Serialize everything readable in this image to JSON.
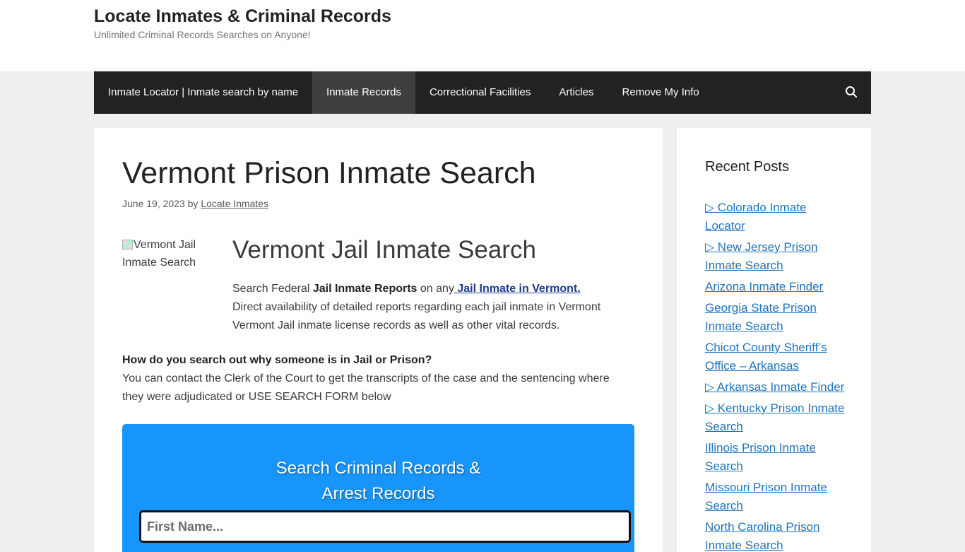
{
  "header": {
    "title": "Locate Inmates & Criminal Records",
    "tagline": "Unlimited Criminal Records Searches on Anyone!"
  },
  "nav": {
    "items": [
      {
        "label": "Inmate Locator | Inmate search by name",
        "active": false
      },
      {
        "label": "Inmate Records",
        "active": true
      },
      {
        "label": "Correctional Facilities",
        "active": false
      },
      {
        "label": "Articles",
        "active": false
      },
      {
        "label": "Remove My Info",
        "active": false
      }
    ],
    "search_icon": "search-icon"
  },
  "article": {
    "title": "Vermont Prison Inmate Search",
    "date": "June 19, 2023",
    "by": "by",
    "author": "Locate Inmates",
    "image_alt": "Vermont Jail Inmate Search",
    "subtitle": "Vermont Jail Inmate Search",
    "intro": {
      "p1": "Search Federal ",
      "bold": "Jail Inmate Reports",
      "p2": " on any",
      "link": " Jail Inmate in Vermont.",
      "p3": "Direct availability of detailed reports regarding each jail inmate in Vermont Vermont Jail inmate license records as well as other vital records."
    },
    "faq_question": "How do you search out why someone is in Jail or Prison?",
    "faq_answer": "You can contact the Clerk of the Court to get the transcripts of the case and the sentencing where they were adjudicated or USE SEARCH FORM below"
  },
  "search_form": {
    "title_line1": "Search Criminal Records &",
    "title_line2": "Arrest Records",
    "first_name_placeholder": "First Name..."
  },
  "sidebar": {
    "title": "Recent Posts",
    "posts": [
      "▷ Colorado Inmate Locator",
      "▷ New Jersey Prison Inmate Search",
      "Arizona Inmate Finder",
      "Georgia State Prison Inmate Search",
      "Chicot County Sheriff’s Office – Arkansas",
      "▷ Arkansas Inmate Finder",
      "▷ Kentucky Prison Inmate Search",
      "Illinois Prison Inmate Search",
      "Missouri Prison Inmate Search",
      "North Carolina Prison Inmate Search"
    ]
  },
  "colors": {
    "nav_bg": "#222222",
    "nav_active": "#3f3f3f",
    "search_box": "#1795fb",
    "link": "#1e73be"
  }
}
